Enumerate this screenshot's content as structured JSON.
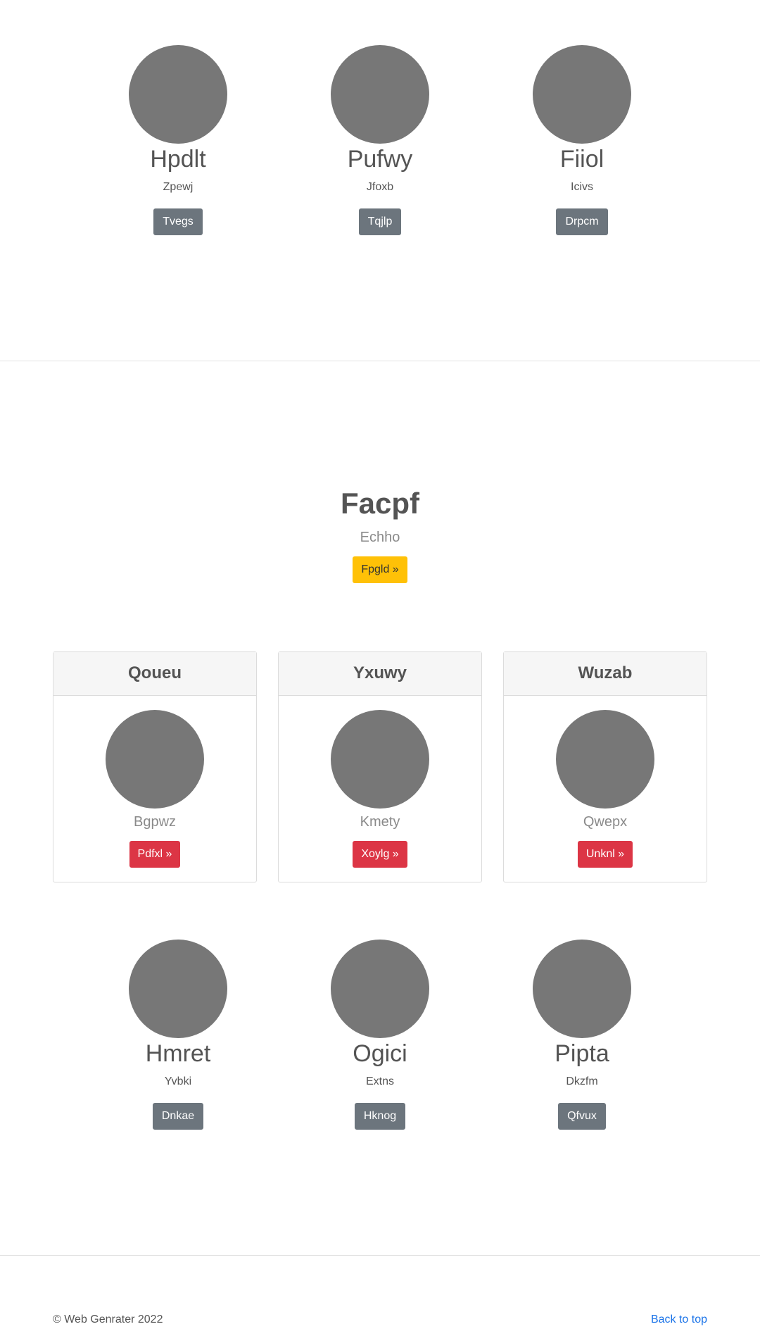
{
  "team_top": [
    {
      "name": "Hpdlt",
      "role": "Zpewj",
      "button": "Tvegs"
    },
    {
      "name": "Pufwy",
      "role": "Jfoxb",
      "button": "Tqjlp"
    },
    {
      "name": "Fiiol",
      "role": "Icivs",
      "button": "Drpcm"
    }
  ],
  "hero": {
    "title": "Facpf",
    "subtitle": "Echho",
    "button": "Fpgld »"
  },
  "cards": [
    {
      "header": "Qoueu",
      "text": "Bgpwz",
      "button": "Pdfxl »"
    },
    {
      "header": "Yxuwy",
      "text": "Kmety",
      "button": "Xoylg »"
    },
    {
      "header": "Wuzab",
      "text": "Qwepx",
      "button": "Unknl »"
    }
  ],
  "team_bottom": [
    {
      "name": "Hmret",
      "role": "Yvbki",
      "button": "Dnkae"
    },
    {
      "name": "Ogici",
      "role": "Extns",
      "button": "Hknog"
    },
    {
      "name": "Pipta",
      "role": "Dkzfm",
      "button": "Qfvux"
    }
  ],
  "footer": {
    "copyright": "© Web Genrater 2022",
    "back_to_top": "Back to top"
  },
  "colors": {
    "avatar": "#777777",
    "secondary_button": "#6c757d",
    "warning_button": "#ffc107",
    "danger_button": "#dc3545",
    "link": "#1a73e8"
  }
}
